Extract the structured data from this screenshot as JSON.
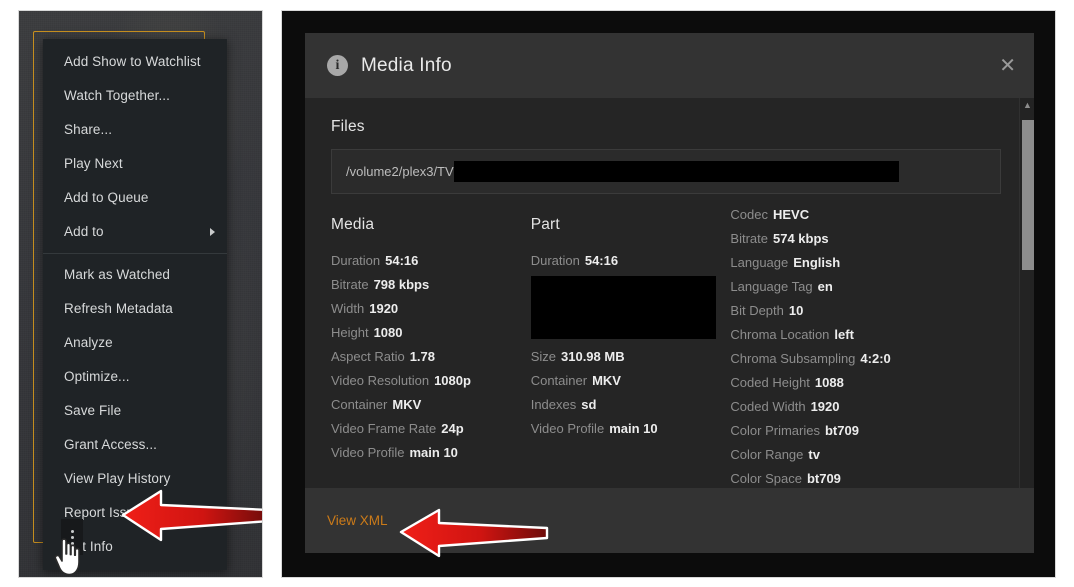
{
  "context_menu": {
    "items": [
      {
        "label": "Add Show to Watchlist",
        "submenu": false
      },
      {
        "label": "Watch Together...",
        "submenu": false
      },
      {
        "label": "Share...",
        "submenu": false
      },
      {
        "label": "Play Next",
        "submenu": false
      },
      {
        "label": "Add to Queue",
        "submenu": false
      },
      {
        "label": "Add to",
        "submenu": true
      }
    ],
    "items2": [
      {
        "label": "Mark as Watched"
      },
      {
        "label": "Refresh Metadata"
      },
      {
        "label": "Analyze"
      },
      {
        "label": "Optimize..."
      },
      {
        "label": "Save File"
      },
      {
        "label": "Grant Access..."
      },
      {
        "label": "View Play History"
      },
      {
        "label": "Report Issue..."
      },
      {
        "label": "Get Info"
      }
    ],
    "more_button_icon": "three-dots-vertical-icon"
  },
  "dialog": {
    "title": "Media Info",
    "title_icon": "info-circle-icon",
    "close_label": "✕",
    "files": {
      "heading": "Files",
      "path_visible": "/volume2/plex3/TV",
      "path_redacted": true
    },
    "media": {
      "heading": "Media",
      "rows": [
        {
          "key": "Duration",
          "value": "54:16"
        },
        {
          "key": "Bitrate",
          "value": "798 kbps"
        },
        {
          "key": "Width",
          "value": "1920"
        },
        {
          "key": "Height",
          "value": "1080"
        },
        {
          "key": "Aspect Ratio",
          "value": "1.78"
        },
        {
          "key": "Video Resolution",
          "value": "1080p"
        },
        {
          "key": "Container",
          "value": "MKV"
        },
        {
          "key": "Video Frame Rate",
          "value": "24p"
        },
        {
          "key": "Video Profile",
          "value": "main 10"
        }
      ]
    },
    "part": {
      "heading": "Part",
      "rows_top": [
        {
          "key": "Duration",
          "value": "54:16"
        }
      ],
      "rows_bottom": [
        {
          "key": "Size",
          "value": "310.98 MB"
        },
        {
          "key": "Container",
          "value": "MKV"
        },
        {
          "key": "Indexes",
          "value": "sd"
        },
        {
          "key": "Video Profile",
          "value": "main 10"
        }
      ]
    },
    "stream": {
      "rows": [
        {
          "key": "Codec",
          "value": "HEVC"
        },
        {
          "key": "Bitrate",
          "value": "574 kbps"
        },
        {
          "key": "Language",
          "value": "English"
        },
        {
          "key": "Language Tag",
          "value": "en"
        },
        {
          "key": "Bit Depth",
          "value": "10"
        },
        {
          "key": "Chroma Location",
          "value": "left"
        },
        {
          "key": "Chroma Subsampling",
          "value": "4:2:0"
        },
        {
          "key": "Coded Height",
          "value": "1088"
        },
        {
          "key": "Coded Width",
          "value": "1920"
        },
        {
          "key": "Color Primaries",
          "value": "bt709"
        },
        {
          "key": "Color Range",
          "value": "tv"
        },
        {
          "key": "Color Space",
          "value": "bt709"
        }
      ]
    },
    "footer": {
      "view_xml_label": "View XML"
    },
    "scrollbar": {
      "up_arrow": "chevron-up-icon",
      "down_arrow": "chevron-down-icon"
    }
  },
  "annotations": {
    "arrow_color": "#e01b15",
    "arrow_get_info": "red-arrow-pointing-to-get-info",
    "arrow_view_xml": "red-arrow-pointing-to-view-xml"
  },
  "colors": {
    "accent_link": "#cc7b19",
    "selection_outline": "#c8901f",
    "dialog_bg": "#252525",
    "dialog_chrome": "#333333",
    "menu_bg": "#1f2326"
  }
}
